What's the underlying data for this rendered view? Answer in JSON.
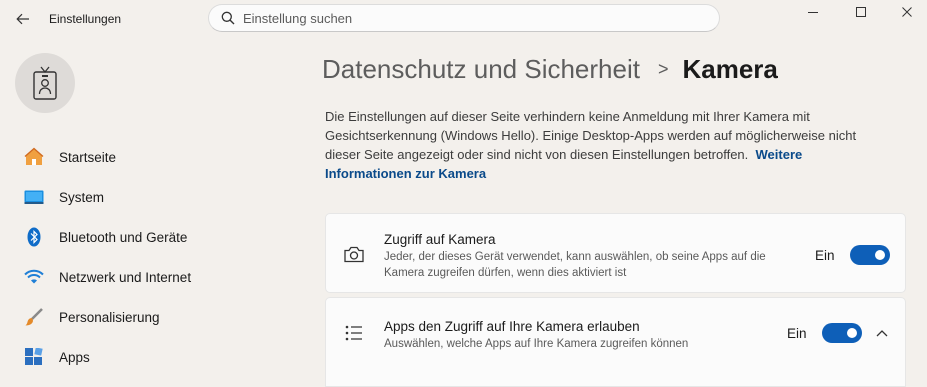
{
  "window": {
    "app_title": "Einstellungen"
  },
  "search": {
    "placeholder": "Einstellung suchen"
  },
  "sidebar": {
    "items": [
      {
        "label": "Startseite"
      },
      {
        "label": "System"
      },
      {
        "label": "Bluetooth und Geräte"
      },
      {
        "label": "Netzwerk und Internet"
      },
      {
        "label": "Personalisierung"
      },
      {
        "label": "Apps"
      }
    ]
  },
  "breadcrumb": {
    "parent": "Datenschutz und Sicherheit",
    "separator": ">",
    "current": "Kamera"
  },
  "description": {
    "text": "Die Einstellungen auf dieser Seite verhindern keine Anmeldung mit Ihrer Kamera mit Gesichtserkennung (Windows Hello). Einige Desktop-Apps werden auf möglicherweise nicht dieser Seite angezeigt oder sind nicht von diesen Einstellungen betroffen.",
    "link": "Weitere Informationen zur Kamera"
  },
  "settings": {
    "camera_access": {
      "title": "Zugriff auf Kamera",
      "subtitle": "Jeder, der dieses Gerät verwendet, kann auswählen, ob seine Apps auf die Kamera zugreifen dürfen, wenn dies aktiviert ist",
      "state": "Ein",
      "on": true
    },
    "apps_access": {
      "title": "Apps den Zugriff auf Ihre Kamera erlauben",
      "subtitle": "Auswählen, welche Apps auf Ihre Kamera zugreifen können",
      "state": "Ein",
      "on": true
    }
  },
  "colors": {
    "accent": "#0e5fb8",
    "background": "#f3f0ec",
    "card": "#fbfbfb",
    "link": "#0a4a8a"
  }
}
